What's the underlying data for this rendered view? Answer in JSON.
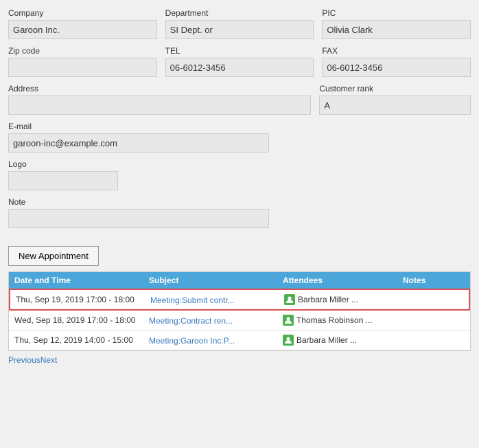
{
  "form": {
    "company_label": "Company",
    "company_value": "Garoon Inc.",
    "department_label": "Department",
    "department_value": "SI Dept. or",
    "pic_label": "PIC",
    "pic_value": "Olivia Clark",
    "zipcode_label": "Zip code",
    "zipcode_value": "",
    "tel_label": "TEL",
    "tel_value": "06-6012-3456",
    "fax_label": "FAX",
    "fax_value": "06-6012-3456",
    "address_label": "Address",
    "address_value": "",
    "customer_rank_label": "Customer rank",
    "customer_rank_value": "A",
    "email_label": "E-mail",
    "email_value": "garoon-inc@example.com",
    "logo_label": "Logo",
    "logo_value": "",
    "note_label": "Note",
    "note_value": ""
  },
  "buttons": {
    "new_appointment": "New Appointment"
  },
  "table": {
    "col_datetime": "Date and Time",
    "col_subject": "Subject",
    "col_attendees": "Attendees",
    "col_notes": "Notes",
    "rows": [
      {
        "datetime": "Thu, Sep 19, 2019 17:00 - 18:00",
        "subject_display": "Meeting:Submit contr...",
        "subject_full": "Meeting:Submit contract",
        "attendee_name": "Barbara Miller ...",
        "notes": "",
        "highlighted": true
      },
      {
        "datetime": "Wed, Sep 18, 2019 17:00 - 18:00",
        "subject_display": "Meeting:Contract ren...",
        "subject_full": "Meeting:Contract renewal",
        "attendee_name": "Thomas Robinson ...",
        "notes": "",
        "highlighted": false
      },
      {
        "datetime": "Thu, Sep 12, 2019 14:00 - 15:00",
        "subject_display": "Meeting:Garoon Inc:P...",
        "subject_full": "Meeting:Garoon Inc:Project",
        "attendee_name": "Barbara Miller ...",
        "notes": "",
        "highlighted": false
      }
    ]
  },
  "pagination": {
    "previous_label": "Previous",
    "next_label": "Next"
  }
}
